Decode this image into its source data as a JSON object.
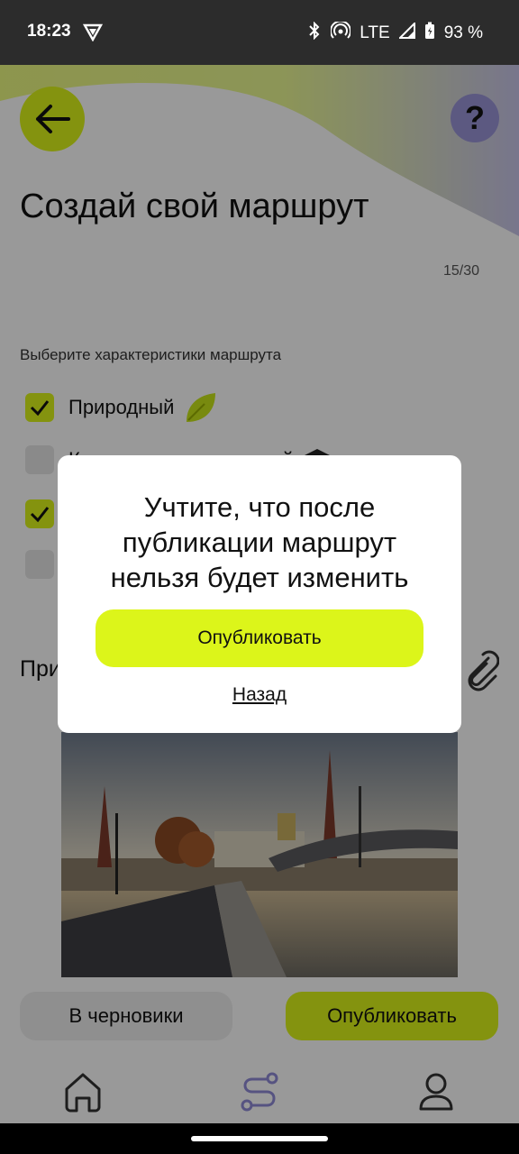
{
  "status": {
    "time": "18:23",
    "network": "LTE",
    "battery": "93 %"
  },
  "header": {
    "title": "Создай свой маршрут",
    "counter": "15/30"
  },
  "characteristics": {
    "label": "Выберите характеристики маршрута",
    "options": [
      {
        "label": "Природный",
        "checked": true,
        "icon": "leaf-icon"
      },
      {
        "label": "Культурно-исторический",
        "checked": false,
        "icon": "graduation-cap-icon"
      },
      {
        "label": "",
        "checked": true
      },
      {
        "label": "",
        "checked": false
      }
    ]
  },
  "attach": {
    "label": "Прикрепите фото",
    "icon": "paperclip-icon"
  },
  "actions": {
    "draft": "В черновики",
    "publish": "Опубликовать"
  },
  "nav": {
    "items": [
      "home-icon",
      "route-icon",
      "profile-icon"
    ]
  },
  "dialog": {
    "message": "Учтите, что после публикации маршрут нельзя будет изменить",
    "confirm": "Опубликовать",
    "cancel": "Назад"
  },
  "colors": {
    "accent": "#dcf51a",
    "help": "#9a95d8",
    "nav_active": "#8f8ad8"
  }
}
